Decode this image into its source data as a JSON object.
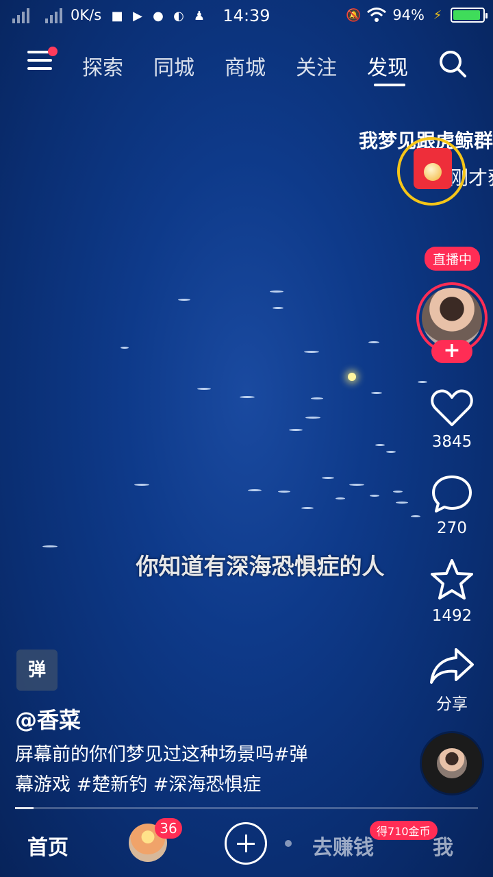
{
  "status_bar": {
    "net_speed": "0K/s",
    "time": "14:39",
    "battery_pct": "94%",
    "battery_level": 0.94,
    "icons": [
      "signal-icon",
      "camera-icon",
      "video-icon",
      "wechat-icon",
      "browser-icon",
      "qq-icon",
      "mute-bell-icon",
      "wifi-icon",
      "charging-icon"
    ]
  },
  "top_nav": {
    "tabs": [
      "探索",
      "同城",
      "商城",
      "关注",
      "发现"
    ],
    "active_tab": "发现"
  },
  "marquee_text": "我梦见跟虎鲸群",
  "redpacket_text": "刚才获",
  "creator": {
    "live_label": "直播中",
    "follow_label": "+"
  },
  "actions": {
    "likes": "3845",
    "comments": "270",
    "favorites": "1492",
    "share_label": "分享"
  },
  "subtitle": "你知道有深海恐惧症的人",
  "video_info": {
    "game_tag": "弹",
    "author": "@香菜",
    "description_line1": "屏幕前的你们梦见过这种场景吗#弹",
    "description_line2": "幕游戏 #楚新钓 #深海恐惧症",
    "progress": 0.04
  },
  "bottom_nav": {
    "home": "首页",
    "friends_badge": "36",
    "earn": "去赚钱",
    "coin_badge": "得710金币",
    "me": "我"
  },
  "colors": {
    "accent": "#ff2d55",
    "ring": "#f5c518",
    "battery": "#3fdc5a",
    "ocean": "#0e3a8a"
  }
}
